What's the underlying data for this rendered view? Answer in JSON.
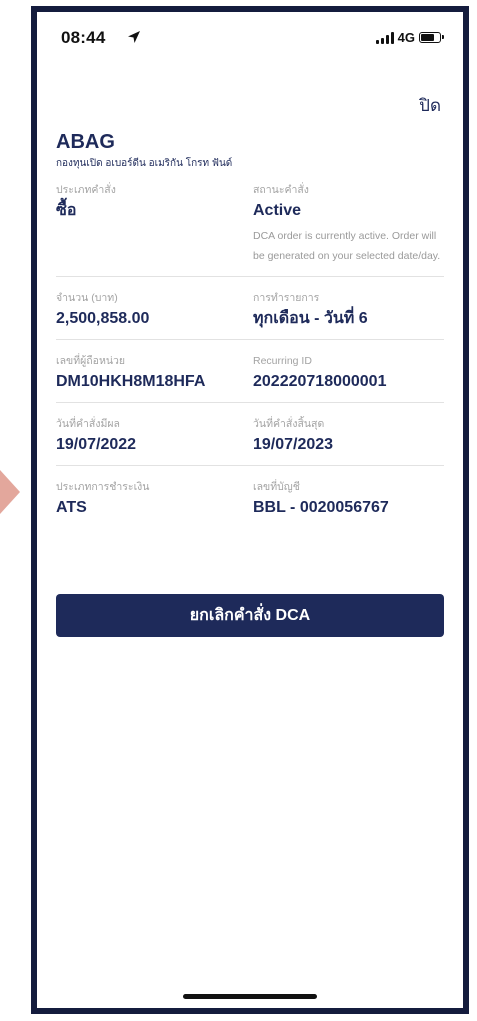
{
  "status_bar": {
    "time": "08:44",
    "network": "4G"
  },
  "header": {
    "close_label": "ปิด"
  },
  "fund": {
    "code": "ABAG",
    "name": "กองทุนเปิด อเบอร์ดีน อเมริกัน โกรท ฟันด์"
  },
  "details": {
    "order_type": {
      "label": "ประเภทคำสั่ง",
      "value": "ซื้อ"
    },
    "order_status": {
      "label": "สถานะคำสั่ง",
      "value": "Active",
      "note": "DCA order is currently active. Order will be generated on your selected date/day."
    },
    "amount": {
      "label": "จำนวน (บาท)",
      "value": "2,500,858.00"
    },
    "frequency": {
      "label": "การทำรายการ",
      "value": "ทุกเดือน - วันที่ 6"
    },
    "unitholder": {
      "label": "เลขที่ผู้ถือหน่วย",
      "value": "DM10HKH8M18HFA"
    },
    "recurring_id": {
      "label": "Recurring ID",
      "value": "202220718000001"
    },
    "effective_date": {
      "label": "วันที่คำสั่งมีผล",
      "value": "19/07/2022"
    },
    "end_date": {
      "label": "วันที่คำสั่งสิ้นสุด",
      "value": "19/07/2023"
    },
    "payment_type": {
      "label": "ประเภทการชำระเงิน",
      "value": "ATS"
    },
    "account_no": {
      "label": "เลขที่บัญชี",
      "value": "BBL - 0020056767"
    }
  },
  "actions": {
    "cancel_label": "ยกเลิกคำสั่ง DCA"
  },
  "colors": {
    "primary": "#1e2a5a",
    "muted": "#a3a3a3",
    "divider": "#e2e2e2",
    "frame": "#141c3d",
    "accent_arrow": "#e3a79c"
  },
  "icons": [
    "location-arrow-icon",
    "signal-icon",
    "battery-icon"
  ]
}
